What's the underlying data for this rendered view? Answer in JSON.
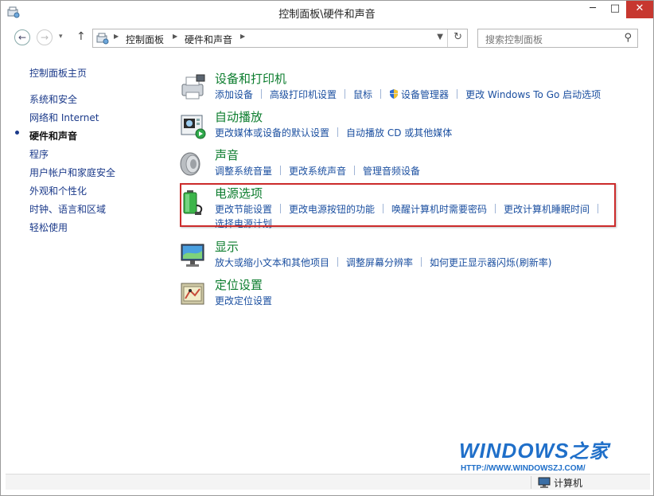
{
  "window": {
    "title": "控制面板\\硬件和声音",
    "minimize": "─",
    "maximize": "□",
    "close": "✕"
  },
  "nav": {
    "back": "←",
    "forward": "→",
    "recent": "▾",
    "up": "↑",
    "breadcrumbs": [
      "控制面板",
      "硬件和声音"
    ],
    "search_placeholder": "搜索控制面板",
    "icons": {
      "back": "back-arrow-icon",
      "forward": "forward-arrow-icon",
      "up": "up-arrow-icon",
      "refresh": "refresh-icon",
      "search": "search-icon"
    }
  },
  "sidebar": {
    "home": "控制面板主页",
    "items": [
      {
        "label": "系统和安全"
      },
      {
        "label": "网络和 Internet"
      },
      {
        "label": "硬件和声音",
        "current": true
      },
      {
        "label": "程序"
      },
      {
        "label": "用户帐户和家庭安全"
      },
      {
        "label": "外观和个性化"
      },
      {
        "label": "时钟、语言和区域"
      },
      {
        "label": "轻松使用"
      }
    ]
  },
  "categories": [
    {
      "title": "设备和打印机",
      "icon": "printer-icon",
      "links": [
        "添加设备",
        "高级打印机设置",
        "鼠标",
        "设备管理器",
        "更改 Windows To Go 启动选项"
      ]
    },
    {
      "title": "自动播放",
      "icon": "autoplay-icon",
      "links": [
        "更改媒体或设备的默认设置",
        "自动播放 CD 或其他媒体"
      ]
    },
    {
      "title": "声音",
      "icon": "speaker-icon",
      "links": [
        "调整系统音量",
        "更改系统声音",
        "管理音频设备"
      ]
    },
    {
      "title": "电源选项",
      "icon": "power-battery-icon",
      "links": [
        "更改节能设置",
        "更改电源按钮的功能",
        "唤醒计算机时需要密码",
        "更改计算机睡眠时间",
        "选择电源计划"
      ]
    },
    {
      "title": "显示",
      "icon": "display-icon",
      "links": [
        "放大或缩小文本和其他项目",
        "调整屏幕分辨率",
        "如何更正显示器闪烁(刷新率)"
      ]
    },
    {
      "title": "定位设置",
      "icon": "location-icon",
      "links": [
        "更改定位设置"
      ]
    }
  ],
  "highlight_color": "#cc2b2b",
  "accent_title_color": "#0c7d2e",
  "link_color": "#1b4fa0",
  "watermark": {
    "logo_main": "WIND",
    "logo_o": "O",
    "logo_rest": "WS",
    "logo_suffix": "之家",
    "url": "HTTP://WWW.WINDOWSZJ.COM/"
  },
  "statusbar": {
    "computer_label": "计算机"
  }
}
